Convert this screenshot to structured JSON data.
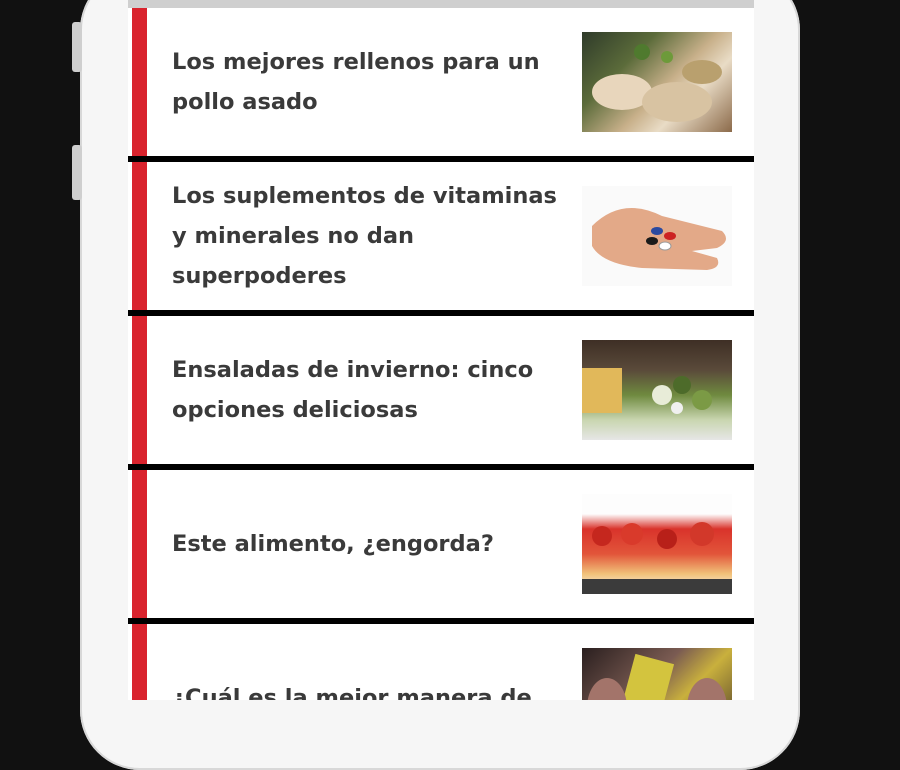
{
  "feed": {
    "items": [
      {
        "title": "Los mejores rellenos para un pollo asado"
      },
      {
        "title": "Los suplementos de vitaminas y minerales no dan superpoderes"
      },
      {
        "title": "Ensaladas de invierno: cinco opciones deliciosas"
      },
      {
        "title": "Este alimento, ¿engorda?"
      },
      {
        "title": "¿Cuál es la mejor manera de"
      }
    ]
  },
  "theme": {
    "accent": "#d9232d",
    "text": "#3a3a3a"
  }
}
